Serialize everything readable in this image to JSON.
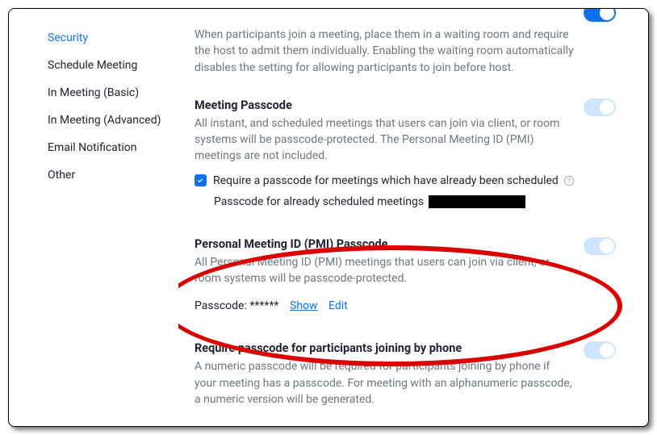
{
  "sidebar": {
    "items": [
      {
        "label": "Security",
        "active": true
      },
      {
        "label": "Schedule Meeting",
        "active": false
      },
      {
        "label": "In Meeting (Basic)",
        "active": false
      },
      {
        "label": "In Meeting (Advanced)",
        "active": false
      },
      {
        "label": "Email Notification",
        "active": false
      },
      {
        "label": "Other",
        "active": false
      }
    ]
  },
  "settings": {
    "waiting_room": {
      "desc": "When participants join a meeting, place them in a waiting room and require the host to admit them individually. Enabling the waiting room automatically disables the setting for allowing participants to join before host."
    },
    "meeting_passcode": {
      "title": "Meeting Passcode",
      "desc": "All instant, and scheduled meetings that users can join via client, or room systems will be passcode-protected. The Personal Meeting ID (PMI) meetings are not included.",
      "require_label": "Require a passcode for meetings which have already been scheduled",
      "scheduled_label": "Passcode for already scheduled meetings"
    },
    "pmi_passcode": {
      "title": "Personal Meeting ID (PMI) Passcode",
      "desc": "All Personal Meeting ID (PMI) meetings that users can join via client, or room systems will be passcode-protected.",
      "passcode_label": "Passcode:",
      "passcode_value": "******",
      "show_label": "Show",
      "edit_label": "Edit"
    },
    "phone_passcode": {
      "title": "Require passcode for participants joining by phone",
      "desc": "A numeric passcode will be required for participants joining by phone if your meeting has a passcode. For meeting with an alphanumeric passcode, a numeric version will be generated."
    }
  }
}
